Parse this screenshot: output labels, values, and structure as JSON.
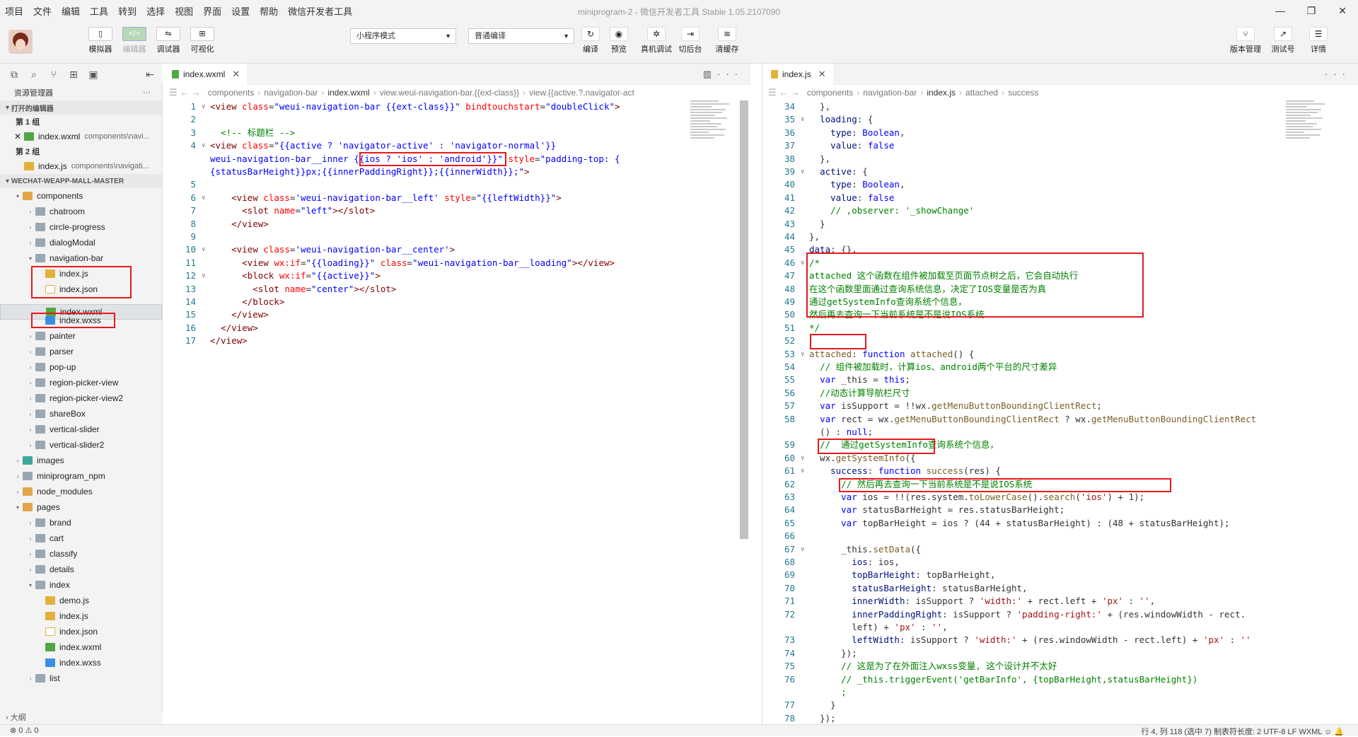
{
  "menu": [
    "项目",
    "文件",
    "编辑",
    "工具",
    "转到",
    "选择",
    "视图",
    "界面",
    "设置",
    "帮助",
    "微信开发者工具"
  ],
  "title": "miniprogram-2 - 微信开发者工具 Stable 1.05.2107090",
  "window_controls": [
    "—",
    "❐",
    "✕"
  ],
  "toolbar": {
    "left_buttons": [
      {
        "label": "模拟器",
        "glyph": "▯"
      },
      {
        "label": "编辑器",
        "glyph": "</>"
      },
      {
        "label": "调试器",
        "glyph": "⇋"
      },
      {
        "label": "可视化",
        "glyph": "⊞"
      }
    ],
    "mode_select": "小程序模式",
    "compile_select": "普通编译",
    "center_buttons": [
      {
        "label": "编译",
        "glyph": "↻"
      },
      {
        "label": "预览",
        "glyph": "◉"
      },
      {
        "label": "真机调试",
        "glyph": "✲"
      },
      {
        "label": "切后台",
        "glyph": "⇥"
      },
      {
        "label": "清缓存",
        "glyph": "≋"
      }
    ],
    "right_buttons": [
      {
        "label": "版本管理",
        "glyph": "⑂"
      },
      {
        "label": "测试号",
        "glyph": "↗"
      },
      {
        "label": "详情",
        "glyph": "☰"
      }
    ]
  },
  "explorer": {
    "title": "资源管理器",
    "more": "···",
    "open_editors": "打开的编辑器",
    "group1": "第 1 组",
    "group1_file": "index.wxml",
    "group1_path": "components\\navi...",
    "group2": "第 2 组",
    "group2_file": "index.js",
    "group2_path": "components\\navigati...",
    "project": "WECHAT-WEAPP-MALL-MASTER",
    "tree": [
      {
        "label": "components",
        "icon": "folder-pkg",
        "indent": 0,
        "open": true
      },
      {
        "label": "chatroom",
        "icon": "folder",
        "indent": 1
      },
      {
        "label": "circle-progress",
        "icon": "folder",
        "indent": 1
      },
      {
        "label": "dialogModal",
        "icon": "folder",
        "indent": 1
      },
      {
        "label": "navigation-bar",
        "icon": "folder",
        "indent": 1,
        "open": true
      },
      {
        "label": "index.js",
        "icon": "js",
        "indent": 2
      },
      {
        "label": "index.json",
        "icon": "json",
        "indent": 2
      },
      {
        "label": "index.wxml",
        "icon": "wxml",
        "indent": 2,
        "selected": true
      },
      {
        "label": "index.wxss",
        "icon": "wxss",
        "indent": 2
      },
      {
        "label": "painter",
        "icon": "folder",
        "indent": 1
      },
      {
        "label": "parser",
        "icon": "folder",
        "indent": 1
      },
      {
        "label": "pop-up",
        "icon": "folder",
        "indent": 1
      },
      {
        "label": "region-picker-view",
        "icon": "folder",
        "indent": 1
      },
      {
        "label": "region-picker-view2",
        "icon": "folder",
        "indent": 1
      },
      {
        "label": "shareBox",
        "icon": "folder",
        "indent": 1
      },
      {
        "label": "vertical-slider",
        "icon": "folder",
        "indent": 1
      },
      {
        "label": "vertical-slider2",
        "icon": "folder",
        "indent": 1
      },
      {
        "label": "images",
        "icon": "folder-img",
        "indent": 0
      },
      {
        "label": "miniprogram_npm",
        "icon": "folder",
        "indent": 0
      },
      {
        "label": "node_modules",
        "icon": "folder-pkg",
        "indent": 0
      },
      {
        "label": "pages",
        "icon": "folder-pkg",
        "indent": 0,
        "open": true
      },
      {
        "label": "brand",
        "icon": "folder",
        "indent": 1
      },
      {
        "label": "cart",
        "icon": "folder",
        "indent": 1
      },
      {
        "label": "classify",
        "icon": "folder",
        "indent": 1
      },
      {
        "label": "details",
        "icon": "folder",
        "indent": 1
      },
      {
        "label": "index",
        "icon": "folder",
        "indent": 1,
        "open": true
      },
      {
        "label": "demo.js",
        "icon": "js",
        "indent": 2
      },
      {
        "label": "index.js",
        "icon": "js",
        "indent": 2
      },
      {
        "label": "index.json",
        "icon": "json",
        "indent": 2
      },
      {
        "label": "index.wxml",
        "icon": "wxml",
        "indent": 2
      },
      {
        "label": "index.wxss",
        "icon": "wxss",
        "indent": 2
      },
      {
        "label": "list",
        "icon": "folder",
        "indent": 1
      }
    ],
    "outline": "大纲"
  },
  "left_editor": {
    "tab": "index.wxml",
    "breadcrumb": [
      "components",
      "navigation-bar",
      "index.wxml",
      "view.weui-navigation-bar.{{ext-class}}",
      "view.{{active.?.navigator-act"
    ],
    "lines": [
      {
        "n": "1",
        "fold": "∨",
        "html": "<span class='tg'>&lt;view</span> <span class='at'>class</span>=<span class='kw'>\"weui-navigation-bar {{ext-class}}\"</span> <span class='at'>bindtouchstart</span>=<span class='kw'>\"doubleClick\"</span><span class='tg'>&gt;</span>"
      },
      {
        "n": "2",
        "html": ""
      },
      {
        "n": "3",
        "html": "  <span class='cm'>&lt;!-- 标题栏 --&gt;</span>"
      },
      {
        "n": "4",
        "fold": "∨",
        "html": "<span class='tg'>&lt;view</span> <span class='at'>class</span>=<span class='kw'>\"{{active ? 'navigator-active' : 'navigator-normal'}}</span>"
      },
      {
        "n": "",
        "html": "<span class='kw'>weui-navigation-bar__inner {{ios ? 'ios' : 'android'}}\"</span> <span class='at'>style</span>=<span class='kw'>\"padding-top: {</span>"
      },
      {
        "n": "",
        "html": "<span class='kw'>{statusBarHeight}}px;{{innerPaddingRight}};{{innerWidth}};\"</span><span class='tg'>&gt;</span>"
      },
      {
        "n": "5",
        "html": ""
      },
      {
        "n": "6",
        "fold": "∨",
        "html": "    <span class='tg'>&lt;view</span> <span class='at'>class</span>=<span class='kw'>'weui-navigation-bar__left'</span> <span class='at'>style</span>=<span class='kw'>\"{{leftWidth}}\"</span><span class='tg'>&gt;</span>"
      },
      {
        "n": "7",
        "html": "      <span class='tg'>&lt;slot</span> <span class='at'>name</span>=<span class='kw'>\"left\"</span><span class='tg'>&gt;&lt;/slot&gt;</span>"
      },
      {
        "n": "8",
        "html": "    <span class='tg'>&lt;/view&gt;</span>"
      },
      {
        "n": "9",
        "html": ""
      },
      {
        "n": "10",
        "fold": "∨",
        "html": "    <span class='tg'>&lt;view</span> <span class='at'>class</span>=<span class='kw'>'weui-navigation-bar__center'</span><span class='tg'>&gt;</span>"
      },
      {
        "n": "11",
        "html": "      <span class='tg'>&lt;view</span> <span class='at'>wx:if</span>=<span class='kw'>\"{{loading}}\"</span> <span class='at'>class</span>=<span class='kw'>\"weui-navigation-bar__loading\"</span><span class='tg'>&gt;&lt;/view&gt;</span>"
      },
      {
        "n": "12",
        "fold": "∨",
        "html": "      <span class='tg'>&lt;block</span> <span class='at'>wx:if</span>=<span class='kw'>\"{{active}}\"</span><span class='tg'>&gt;</span>"
      },
      {
        "n": "13",
        "html": "        <span class='tg'>&lt;slot</span> <span class='at'>name</span>=<span class='kw'>\"center\"</span><span class='tg'>&gt;&lt;/slot&gt;</span>"
      },
      {
        "n": "14",
        "html": "      <span class='tg'>&lt;/block&gt;</span>"
      },
      {
        "n": "15",
        "html": "    <span class='tg'>&lt;/view&gt;</span>"
      },
      {
        "n": "16",
        "html": "  <span class='tg'>&lt;/view&gt;</span>"
      },
      {
        "n": "17",
        "html": "<span class='tg'>&lt;/view&gt;</span>"
      }
    ]
  },
  "right_editor": {
    "tab": "index.js",
    "breadcrumb": [
      "components",
      "navigation-bar",
      "index.js",
      "attached",
      "success"
    ],
    "lines": [
      {
        "n": "34",
        "html": "  },"
      },
      {
        "n": "35",
        "fold": "∨",
        "html": "  <span class='pr'>loading</span>: {"
      },
      {
        "n": "36",
        "html": "    <span class='pr'>type</span>: <span class='kw'>Boolean</span>,"
      },
      {
        "n": "37",
        "html": "    <span class='pr'>value</span>: <span class='kw'>false</span>"
      },
      {
        "n": "38",
        "html": "  },"
      },
      {
        "n": "39",
        "fold": "∨",
        "html": "  <span class='pr'>active</span>: {"
      },
      {
        "n": "40",
        "html": "    <span class='pr'>type</span>: <span class='kw'>Boolean</span>,"
      },
      {
        "n": "41",
        "html": "    <span class='pr'>value</span>: <span class='kw'>false</span>"
      },
      {
        "n": "42",
        "html": "    <span class='cm'>// ,observer: '_showChange'</span>"
      },
      {
        "n": "43",
        "html": "  }"
      },
      {
        "n": "44",
        "html": "},"
      },
      {
        "n": "45",
        "html": "<span class='pr'>data</span>: {},"
      },
      {
        "n": "46",
        "fold": "∨",
        "html": "<span class='cm'>/*</span>"
      },
      {
        "n": "47",
        "html": "<span class='cm'>attached 这个函数在组件被加载至页面节点树之后，它会自动执行</span>"
      },
      {
        "n": "48",
        "html": "<span class='cm'>在这个函数里面通过查询系统信息，决定了IOS变量是否为真</span>"
      },
      {
        "n": "49",
        "html": "<span class='cm'>通过getSystemInfo查询系统个信息，</span>"
      },
      {
        "n": "50",
        "html": "<span class='cm'>然后再去查询一下当前系统是不是说IOS系统</span>"
      },
      {
        "n": "51",
        "html": "<span class='cm'>*/</span>"
      },
      {
        "n": "52",
        "html": ""
      },
      {
        "n": "53",
        "fold": "∨",
        "html": "<span class='fn'>attached</span>: <span class='kw'>function</span> <span class='fn'>attached</span>() {"
      },
      {
        "n": "54",
        "html": "  <span class='cm'>// 组件被加载时，计算ios、android两个平台的尺寸差异</span>"
      },
      {
        "n": "55",
        "html": "  <span class='kw'>var</span> _this = <span class='kw'>this</span>;"
      },
      {
        "n": "56",
        "html": "  <span class='cm'>//动态计算导航栏尺寸</span>"
      },
      {
        "n": "57",
        "html": "  <span class='kw'>var</span> isSupport = !!wx.<span class='fn'>getMenuButtonBoundingClientRect</span>;"
      },
      {
        "n": "58",
        "html": "  <span class='kw'>var</span> rect = wx.<span class='fn'>getMenuButtonBoundingClientRect</span> ? wx.<span class='fn'>getMenuButtonBoundingClientRect</span>"
      },
      {
        "n": "",
        "html": "  () : <span class='kw'>null</span>;"
      },
      {
        "n": "59",
        "html": "  <span class='cm'>//  通过getSystemInfo查询系统个信息，</span>"
      },
      {
        "n": "60",
        "fold": "∨",
        "html": "  wx.<span class='fn'>getSystemInfo</span>({"
      },
      {
        "n": "61",
        "fold": "∨",
        "html": "    <span class='pr'>success</span>: <span class='kw'>function</span> <span class='fn'>success</span>(res) {"
      },
      {
        "n": "62",
        "html": "      <span class='cm'>// 然后再去查询一下当前系统是不是说IOS系统</span>"
      },
      {
        "n": "63",
        "html": "      <span class='kw'>var</span> ios = !!(res.system.<span class='fn'>toLowerCase</span>().<span class='fn'>search</span>(<span class='st'>'ios'</span>) + 1);"
      },
      {
        "n": "64",
        "html": "      <span class='kw'>var</span> statusBarHeight = res.statusBarHeight;"
      },
      {
        "n": "65",
        "html": "      <span class='kw'>var</span> topBarHeight = ios ? (44 + statusBarHeight) : (48 + statusBarHeight);"
      },
      {
        "n": "66",
        "html": ""
      },
      {
        "n": "67",
        "fold": "∨",
        "html": "      _this.<span class='fn'>setData</span>({"
      },
      {
        "n": "68",
        "html": "        <span class='pr'>ios</span>: ios,"
      },
      {
        "n": "69",
        "html": "        <span class='pr'>topBarHeight</span>: topBarHeight,"
      },
      {
        "n": "70",
        "html": "        <span class='pr'>statusBarHeight</span>: statusBarHeight,"
      },
      {
        "n": "71",
        "html": "        <span class='pr'>innerWidth</span>: isSupport ? <span class='st'>'width:'</span> + rect.left + <span class='st'>'px'</span> : <span class='st'>''</span>,"
      },
      {
        "n": "72",
        "html": "        <span class='pr'>innerPaddingRight</span>: isSupport ? <span class='st'>'padding-right:'</span> + (res.windowWidth - rect."
      },
      {
        "n": "",
        "html": "        left) + <span class='st'>'px'</span> : <span class='st'>''</span>,"
      },
      {
        "n": "73",
        "html": "        <span class='pr'>leftWidth</span>: isSupport ? <span class='st'>'width:'</span> + (res.windowWidth - rect.left) + <span class='st'>'px'</span> : <span class='st'>''</span>"
      },
      {
        "n": "74",
        "html": "      });"
      },
      {
        "n": "75",
        "html": "      <span class='cm'>// 这是为了在外面注入wxss变量, 这个设计并不太好</span>"
      },
      {
        "n": "76",
        "html": "      <span class='cm'>// _this.triggerEvent('getBarInfo', {topBarHeight,statusBarHeight})</span>"
      },
      {
        "n": "",
        "html": "      <span class='cm'>;</span>"
      },
      {
        "n": "77",
        "html": "    }"
      },
      {
        "n": "78",
        "html": "  });"
      },
      {
        "n": "79",
        "html": ""
      }
    ]
  },
  "status": {
    "left": "⊗ 0 ⚠ 0",
    "right": "行 4, 列 118 (选中 7)   制表符长度: 2   UTF-8   LF   WXML   ☺  🔔"
  }
}
